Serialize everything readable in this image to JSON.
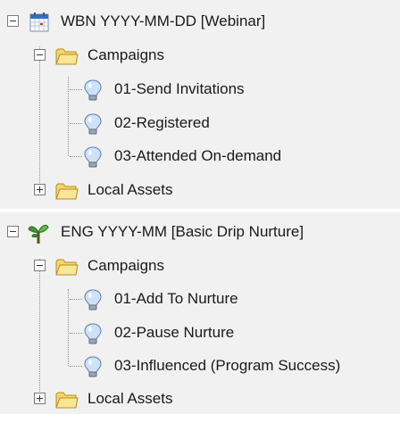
{
  "programs": [
    {
      "title": "WBN YYYY-MM-DD [Webinar]",
      "icon": "calendar-icon",
      "folders": [
        {
          "label": "Campaigns",
          "expanded": true,
          "campaigns": [
            "01-Send Invitations",
            "02-Registered",
            "03-Attended On-demand"
          ]
        },
        {
          "label": "Local Assets",
          "expanded": false
        }
      ]
    },
    {
      "title": "ENG YYYY-MM [Basic Drip Nurture]",
      "icon": "sprout-icon",
      "folders": [
        {
          "label": "Campaigns",
          "expanded": true,
          "campaigns": [
            "01-Add To Nurture",
            "02-Pause Nurture",
            "03-Influenced (Program Success)"
          ]
        },
        {
          "label": "Local Assets",
          "expanded": false
        }
      ]
    }
  ],
  "colors": {
    "panel_bg": "#f1f1f1",
    "folder_fill": "#f6d66c",
    "folder_stroke": "#b88a1e",
    "bulb_glass": "#cfe1f7",
    "bulb_stroke": "#5b7fae",
    "calendar_header": "#2e6fc4",
    "calendar_mark": "#d9342b",
    "sprout_leaf": "#3d9a2a"
  }
}
